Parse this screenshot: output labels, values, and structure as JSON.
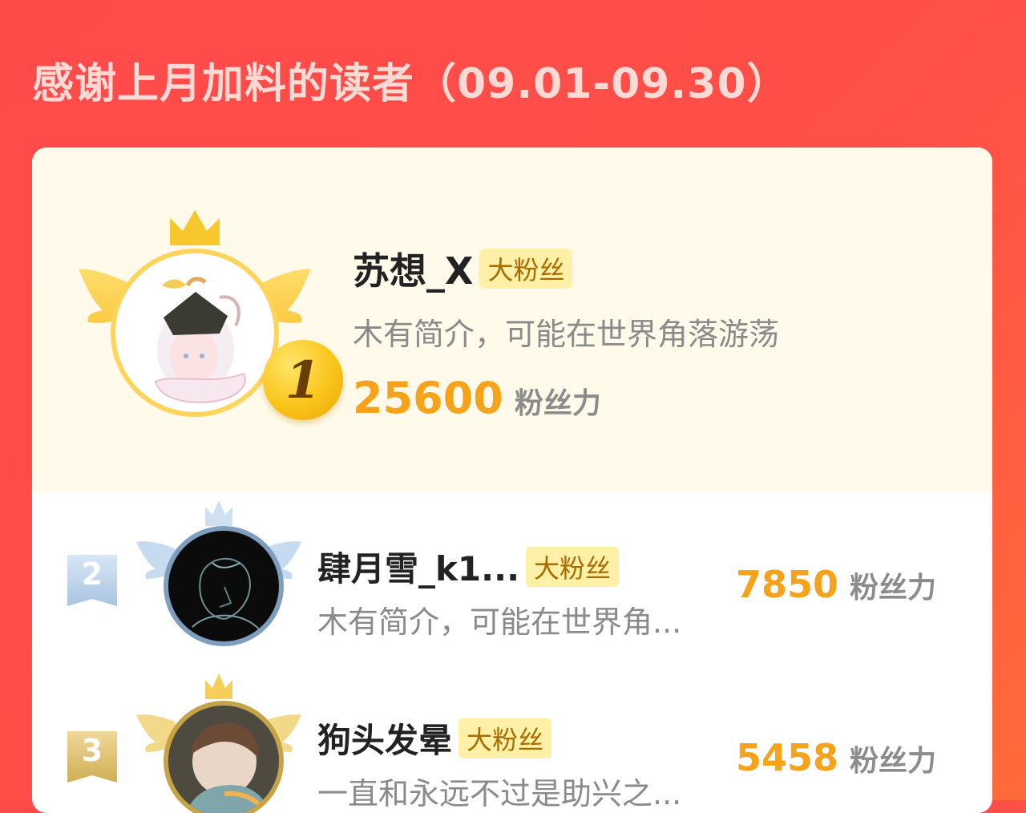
{
  "header": {
    "title": "感谢上月加料的读者（09.01-09.30）"
  },
  "colors": {
    "background": "#ff4a4a",
    "card_top": "#fffaea",
    "score": "#f6a21b",
    "badge_bg": "#fff0a8",
    "badge_text": "#a86b00",
    "gold": "#f9c41a",
    "silver": "#b9d1ea",
    "bronze": "#d7b562"
  },
  "leaderboard": {
    "first": {
      "rank": "1",
      "name": "苏想_X",
      "badge": "大粉丝",
      "bio": "木有简介，可能在世界角落游荡",
      "score": "25600",
      "unit": "粉丝力"
    },
    "rows": [
      {
        "rank": "2",
        "name": "肆月雪_k1...",
        "badge": "大粉丝",
        "bio": "木有简介，可能在世界角...",
        "score": "7850",
        "unit": "粉丝力"
      },
      {
        "rank": "3",
        "name": "狗头发晕",
        "badge": "大粉丝",
        "bio": "一直和永远不过是助兴之...",
        "score": "5458",
        "unit": "粉丝力"
      }
    ]
  },
  "icons": {
    "crown": "crown-icon",
    "wings": "wings-icon",
    "medal": "gold-medal-icon",
    "rank_tag": "rank-ribbon-icon"
  }
}
